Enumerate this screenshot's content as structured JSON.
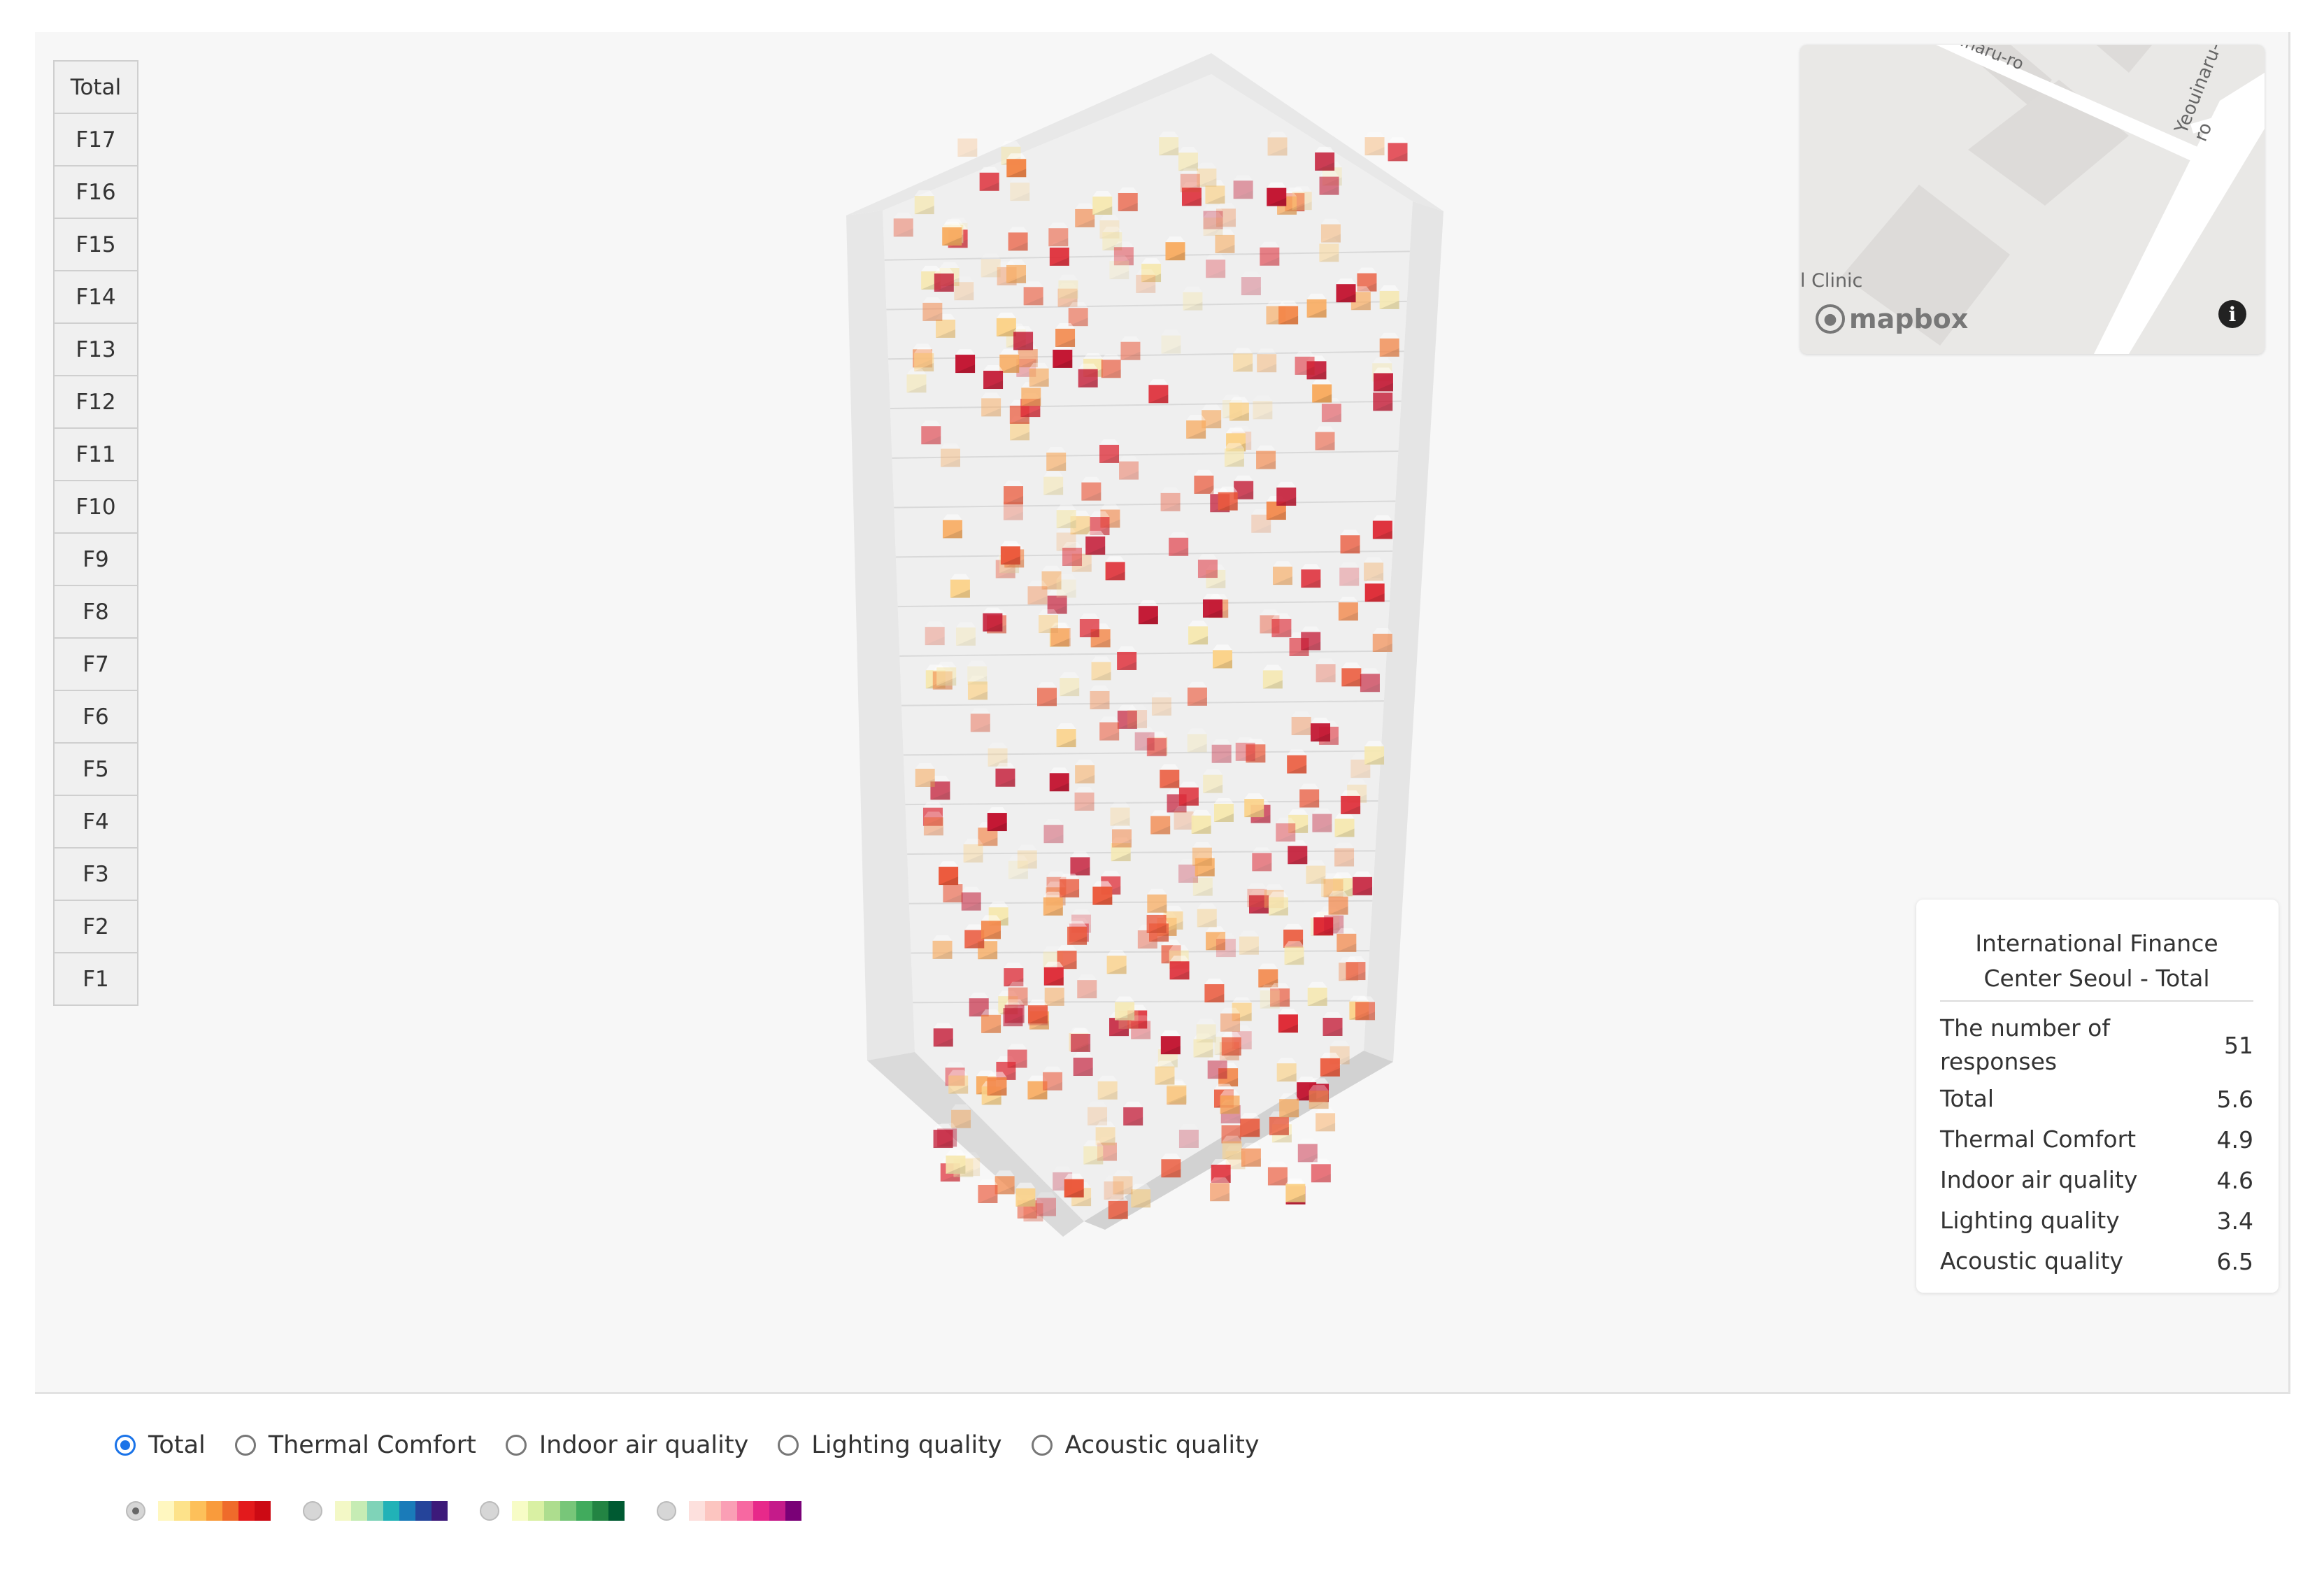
{
  "floors": [
    "Total",
    "F17",
    "F16",
    "F15",
    "F14",
    "F13",
    "F12",
    "F11",
    "F10",
    "F9",
    "F8",
    "F7",
    "F6",
    "F5",
    "F4",
    "F3",
    "F2",
    "F1"
  ],
  "map": {
    "street_top": "...naru-ro",
    "street_right": "Yeouinaru-ro",
    "place": "l Clinic",
    "logo_text": "mapbox",
    "info_icon": "i"
  },
  "panel": {
    "title": "International Finance Center Seoul - Total",
    "rows": [
      {
        "label": "The number of responses",
        "value": "51"
      },
      {
        "label": "Total",
        "value": "5.6"
      },
      {
        "label": "Thermal Comfort",
        "value": "4.9"
      },
      {
        "label": "Indoor air quality",
        "value": "4.6"
      },
      {
        "label": "Lighting quality",
        "value": "3.4"
      },
      {
        "label": "Acoustic quality",
        "value": "6.5"
      }
    ]
  },
  "categories": [
    {
      "label": "Total",
      "checked": true
    },
    {
      "label": "Thermal Comfort",
      "checked": false
    },
    {
      "label": "Indoor air quality",
      "checked": false
    },
    {
      "label": "Lighting quality",
      "checked": false
    },
    {
      "label": "Acoustic quality",
      "checked": false
    }
  ],
  "palettes": [
    {
      "name": "yellow-orange-red",
      "checked": true,
      "colors": [
        "#fff7c0",
        "#fde28a",
        "#fdc05a",
        "#f99b3c",
        "#ef6b2b",
        "#e31a1c",
        "#cc0a14"
      ]
    },
    {
      "name": "yellow-green-blue-purple",
      "checked": false,
      "colors": [
        "#f3f8c6",
        "#c6ecb4",
        "#7fd3b8",
        "#21b2b7",
        "#1a7bb9",
        "#25449a",
        "#3d1a7a"
      ]
    },
    {
      "name": "yellow-green",
      "checked": false,
      "colors": [
        "#f7fcc6",
        "#d9f0a3",
        "#addd8e",
        "#78c679",
        "#41ab5d",
        "#238443",
        "#005a32"
      ]
    },
    {
      "name": "pink-purple",
      "checked": false,
      "colors": [
        "#fde0dd",
        "#fcc5c0",
        "#fa9fb5",
        "#f768a1",
        "#e7298a",
        "#c51b8a",
        "#7a0177"
      ]
    }
  ],
  "colors": {
    "accent": "#1a73e8",
    "sensor_scale": [
      "#f7e9b0",
      "#fcd38a",
      "#f9ad62",
      "#f4884a",
      "#ec5a3c",
      "#df2b36",
      "#c41834"
    ]
  }
}
